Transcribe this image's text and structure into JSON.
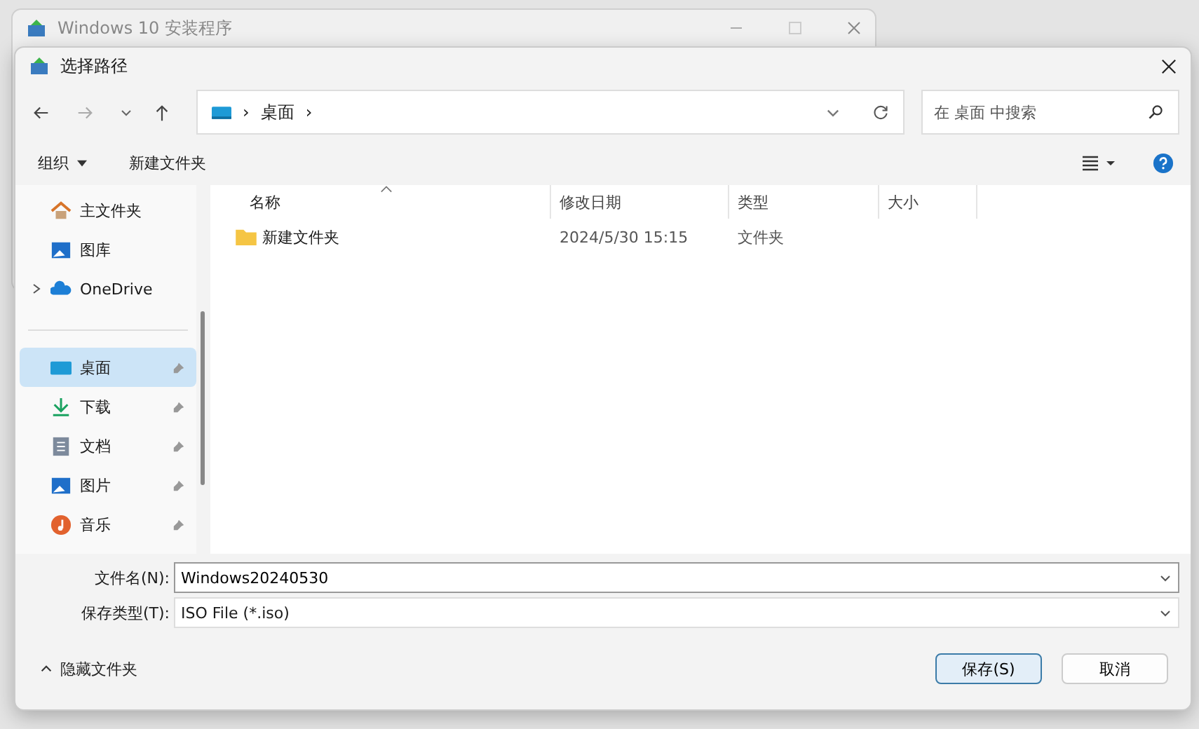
{
  "back_window": {
    "title": "Windows 10 安装程序"
  },
  "dialog": {
    "title": "选择路径"
  },
  "address_bar": {
    "crumbs": [
      "›",
      "桌面",
      "›"
    ]
  },
  "search": {
    "placeholder": "在 桌面 中搜索"
  },
  "toolbar": {
    "organize": "组织",
    "new_folder": "新建文件夹"
  },
  "sidebar": {
    "top": [
      {
        "label": "主文件夹",
        "kind": "plain"
      },
      {
        "label": "图库",
        "kind": "plain"
      },
      {
        "label": "OneDrive",
        "kind": "expandable",
        "expanded": false
      }
    ],
    "pinned": [
      {
        "label": "桌面",
        "selected": true,
        "pinned": true
      },
      {
        "label": "下载",
        "selected": false,
        "pinned": true
      },
      {
        "label": "文档",
        "selected": false,
        "pinned": true
      },
      {
        "label": "图片",
        "selected": false,
        "pinned": true
      },
      {
        "label": "音乐",
        "selected": false,
        "pinned": true
      }
    ]
  },
  "table": {
    "columns": [
      {
        "label": "名称",
        "sorted": true
      },
      {
        "label": "修改日期",
        "sorted": false
      },
      {
        "label": "类型",
        "sorted": false
      },
      {
        "label": "大小",
        "sorted": false
      }
    ],
    "rows": [
      {
        "name": "新建文件夹",
        "date": "2024/5/30 15:15",
        "type": "文件夹",
        "size": ""
      }
    ]
  },
  "filename": {
    "label": "文件名(N):",
    "value": "Windows20240530"
  },
  "filetype": {
    "label": "保存类型(T):",
    "value": "ISO File (*.iso)"
  },
  "hide_folders": "隐藏文件夹",
  "buttons": [
    {
      "label": "保存(S)",
      "selected": true
    },
    {
      "label": "取消",
      "selected": false
    }
  ]
}
